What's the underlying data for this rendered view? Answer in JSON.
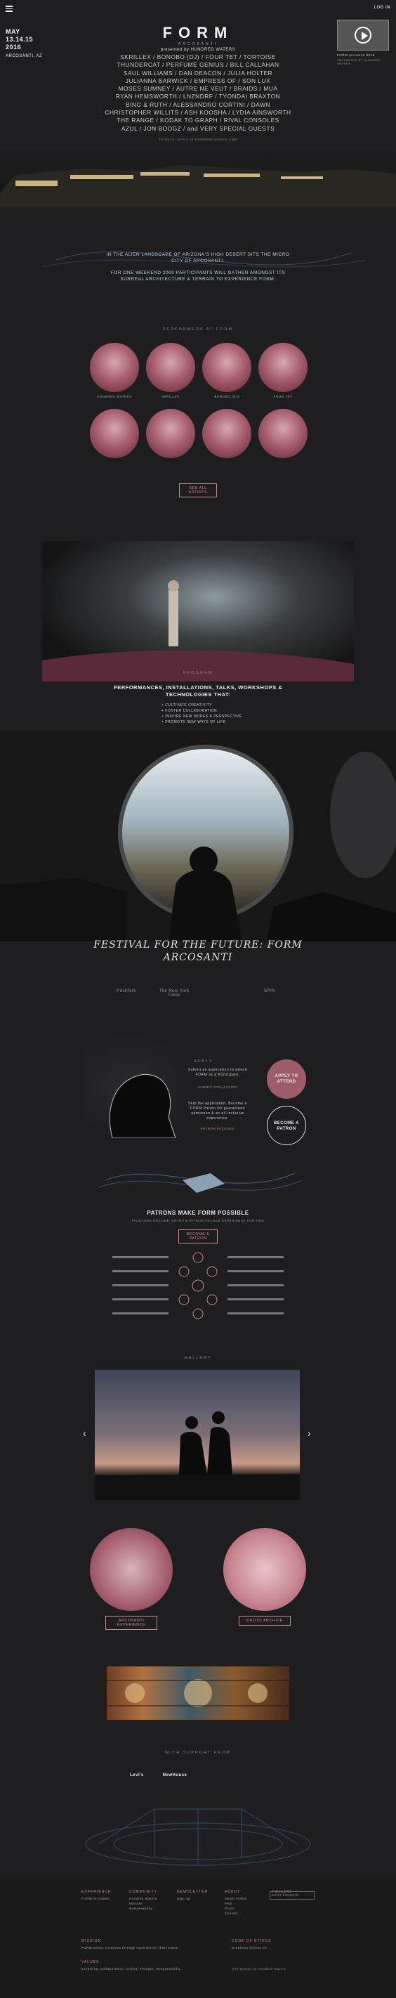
{
  "header": {
    "menu_icon": "hamburger-icon",
    "date_line1": "MAY",
    "date_line2": "13.14.15",
    "date_line3": "2016",
    "location": "ARCOSANTI, AZ",
    "logo": "FORM",
    "logo_sub": "ARCOSANTI",
    "presented": "presented by HUNDRED WATERS",
    "login": "LOG IN",
    "video_caption": "FORM Arcosanti 2016",
    "video_sub": "PRESENTED BY HUNDRED WATERS"
  },
  "lineup": [
    "SKRILLEX / BONOBO (DJ) / FOUR TET / TORTOISE",
    "THUNDERCAT / PERFUME GENIUS / BILL CALLAHAN",
    "SAUL WILLIAMS / DAN DEACON / JULIA HOLTER",
    "JULIANNA BARWICK / EMPRESS OF / SON LUX",
    "MOSES SUMNEY / AUTRE NE VEUT / BRAIDS / MUA",
    "RYAN HEMSWORTH / LNZNDRF / TYONDAI BRAXTON",
    "BING & RUTH / ALESSANDRO CORTINI / DAWN",
    "CHRISTOPHER WILLITS / ASH KOOSHA / LYDIA AINSWORTH",
    "THE RANGE / KODAK TO GRAPH / RIVAL CONSOLES",
    "AZUL / JON BOOGZ / and VERY SPECIAL GUESTS"
  ],
  "lineup_note": "TICKETS: APPLY AT FORMARCOSANTI.COM",
  "intro": {
    "p1": "IN THE ALIEN LANDSCAPE OF ARIZONA'S HIGH DESERT SITS THE MICRO CITY OF ARCOSANTI.",
    "p2": "FOR ONE WEEKEND 2000 PARTICIPANTS WILL GATHER AMONGST ITS SURREAL ARCHITECTURE & TERRAIN TO EXPERIENCE FORM."
  },
  "performers_title": "PERFORMERS AT FORM",
  "performers": [
    "HUNDRED WATERS",
    "SKRILLEX",
    "BONOBO (DJ)",
    "FOUR TET",
    "",
    "",
    "",
    ""
  ],
  "all_artists_btn": "SEE ALL ARTISTS",
  "program": {
    "label": "PROGRAM",
    "title": "PERFORMANCES, INSTALLATIONS, TALKS, WORKSHOPS & TECHNOLOGIES THAT:",
    "items": [
      "+ CULTIVATE CREATIVITY",
      "+ FOSTER COLLABORATION",
      "+ INSPIRE NEW MODES & PERSPECTIVE",
      "+ PROMOTE NEW WAYS OF LIFE"
    ]
  },
  "quote": "FESTIVAL FOR THE FUTURE: FORM ARCOSANTI",
  "press": [
    "Pitchfork",
    "The New York Times",
    "",
    "SPIN"
  ],
  "apply": {
    "label": "APPLY",
    "text1": "Submit an application to attend FORM as a Participant.",
    "link1": "SUBMIT APPLICATION",
    "text2": "Skip the application. Become a FORM Patron for guaranteed admission & an all-inclusive experience.",
    "link2": "PATRON PACKAGE",
    "circle1": "APPLY TO ATTEND",
    "circle2": "BECOME A PATRON"
  },
  "patrons": {
    "title": "PATRONS MAKE FORM POSSIBLE",
    "sub": "PACKAGES INCLUDE: ENTRY & PATRON VILLAGE EXPERIENCE FOR TWO",
    "btn": "BECOME A PATRON"
  },
  "gallery": {
    "label": "GALLERY",
    "prev": "‹",
    "next": "›"
  },
  "cards": {
    "left": "ARCOSANTI EXPERIENCE",
    "right": "PHOTO ARCHIVE"
  },
  "support": {
    "title": "WITH SUPPORT FROM",
    "logos": [
      "Levi's",
      "NewHouse",
      "",
      ""
    ]
  },
  "footer": {
    "cols": [
      {
        "head": "EXPERIENCE",
        "items": [
          "FORM Arcosanti"
        ]
      },
      {
        "head": "COMMUNITY",
        "items": [
          "Hundred Waters",
          "Mission",
          "Sustainability"
        ]
      },
      {
        "head": "NEWSLETTER",
        "items": [
          "Sign up"
        ]
      },
      {
        "head": "ABOUT",
        "items": [
          "About FORM",
          "FAQ",
          "Press",
          "Contact"
        ]
      },
      {
        "head": "FOLLOW",
        "items": []
      }
    ],
    "search_placeholder": "enter keyword",
    "mission_head": "MISSION",
    "mission_text": "FORM unites creatives through experiences that inspire.",
    "values_head": "VALUES",
    "values_text": "Creativity, Collaboration, Critical Thought, Responsibility",
    "code_head": "CODE OF ETHICS",
    "code_text": "Creativity thrives on ...",
    "credit": "Site Design by Hundred Waters"
  },
  "colors": {
    "bg": "#1e1e20",
    "accent": "#c98892"
  }
}
